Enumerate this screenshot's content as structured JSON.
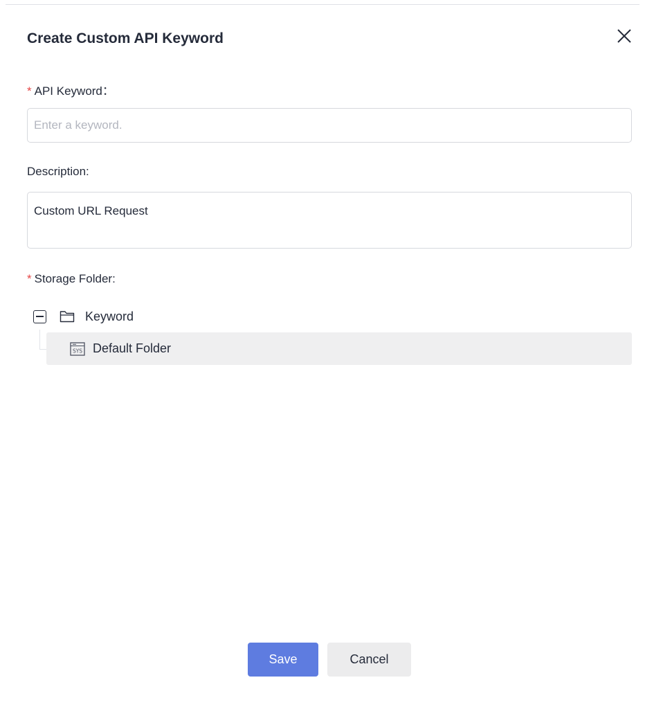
{
  "dialog": {
    "title": "Create Custom API Keyword"
  },
  "form": {
    "keyword": {
      "required_mark": "*",
      "label": "API Keyword：",
      "placeholder": "Enter a keyword.",
      "value": ""
    },
    "description": {
      "label": "Description:",
      "value": "Custom URL Request"
    },
    "storage_folder": {
      "required_mark": "*",
      "label": "Storage Folder:"
    }
  },
  "tree": {
    "root": {
      "label": "Keyword",
      "expanded": true,
      "icon": "folder-icon"
    },
    "children": [
      {
        "label": "Default Folder",
        "icon": "system-folder-icon",
        "selected": true
      }
    ]
  },
  "footer": {
    "save_label": "Save",
    "cancel_label": "Cancel"
  },
  "colors": {
    "primary": "#5e7ce0",
    "required": "#e54545",
    "selected_row": "#efeff0"
  }
}
